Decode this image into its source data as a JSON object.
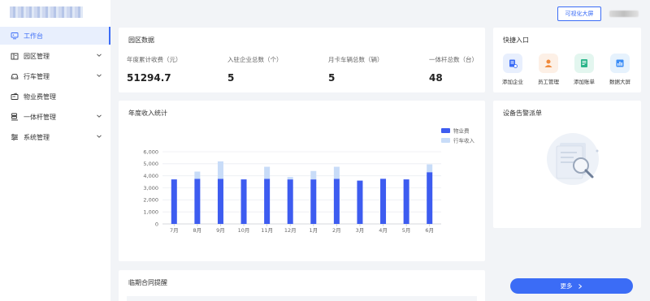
{
  "topbar": {
    "visualize_button": "可视化大屏"
  },
  "sidebar": {
    "items": [
      {
        "label": "工作台",
        "icon": "monitor-icon",
        "active": true,
        "has_arrow": false
      },
      {
        "label": "园区管理",
        "icon": "building-icon",
        "active": false,
        "has_arrow": true
      },
      {
        "label": "行车管理",
        "icon": "car-icon",
        "active": false,
        "has_arrow": true
      },
      {
        "label": "物业费管理",
        "icon": "wallet-icon",
        "active": false,
        "has_arrow": false
      },
      {
        "label": "一体杆管理",
        "icon": "pole-icon",
        "active": false,
        "has_arrow": true
      },
      {
        "label": "系统管理",
        "icon": "sliders-icon",
        "active": false,
        "has_arrow": true
      }
    ]
  },
  "park": {
    "title": "园区数据",
    "stats": [
      {
        "label": "年度累计收费（元）",
        "value": "51294.7"
      },
      {
        "label": "入驻企业总数（个）",
        "value": "5"
      },
      {
        "label": "月卡车辆总数（辆）",
        "value": "5"
      },
      {
        "label": "一体杆总数（台）",
        "value": "48"
      }
    ]
  },
  "quick": {
    "title": "快捷入口",
    "items": [
      {
        "label": "添加企业",
        "icon": "add-company-icon",
        "bg": "#e8effd",
        "color": "#3b6cf6"
      },
      {
        "label": "员工管理",
        "icon": "staff-icon",
        "bg": "#fdf0e6",
        "color": "#f08a3c"
      },
      {
        "label": "添加账单",
        "icon": "bill-icon",
        "bg": "#e3f6ef",
        "color": "#2bb58a"
      },
      {
        "label": "数据大屏",
        "icon": "data-screen-icon",
        "bg": "#e6f2fd",
        "color": "#3b8df6"
      }
    ]
  },
  "income": {
    "title": "年度收入统计",
    "legend": [
      "物业费",
      "行车收入"
    ]
  },
  "alarm": {
    "title": "设备告警派单",
    "more_button": "更多"
  },
  "contract": {
    "title": "临期合同提醒"
  },
  "colors": {
    "accent": "#3b6cf6",
    "series1": "#3d5cf0",
    "series2": "#c8dcf8"
  },
  "chart_data": {
    "type": "bar",
    "stacked": true,
    "categories": [
      "7月",
      "8月",
      "9月",
      "10月",
      "11月",
      "12月",
      "1月",
      "2月",
      "3月",
      "4月",
      "5月",
      "6月"
    ],
    "series": [
      {
        "name": "物业费",
        "values": [
          3700,
          3750,
          3750,
          3700,
          3750,
          3700,
          3700,
          3750,
          3600,
          3750,
          3700,
          4300
        ]
      },
      {
        "name": "行车收入",
        "values": [
          0,
          600,
          1450,
          0,
          1000,
          200,
          700,
          1000,
          0,
          0,
          0,
          650
        ]
      }
    ],
    "ylim": [
      0,
      6000
    ],
    "yticks": [
      "0",
      "1,000",
      "2,000",
      "3,000",
      "4,000",
      "5,000",
      "6,000"
    ],
    "legend_position": "top-right"
  }
}
